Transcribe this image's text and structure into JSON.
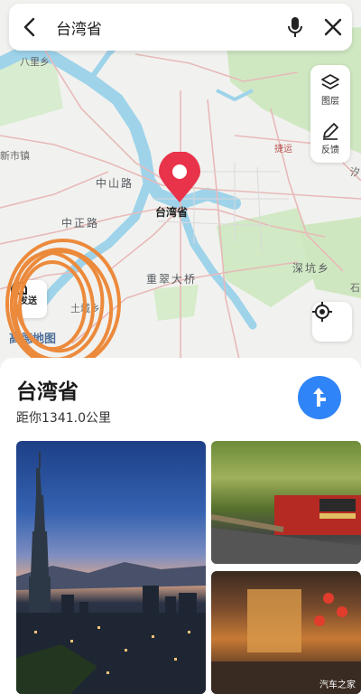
{
  "search": {
    "query": "台湾省"
  },
  "map": {
    "labels": [
      "八里乡",
      "新市镇",
      "中山路",
      "中正路",
      "重翠大桥",
      "土城乡",
      "深坑乡",
      "汐",
      "石",
      "捷运"
    ],
    "pin_label": "台湾省",
    "brand": "高德地图",
    "send_label": "发送"
  },
  "tools": {
    "layers_label": "图层",
    "feedback_label": "反馈"
  },
  "place": {
    "name": "台湾省",
    "distance": "距你1341.0公里"
  },
  "photos": {
    "watermark": "汽车之家"
  }
}
